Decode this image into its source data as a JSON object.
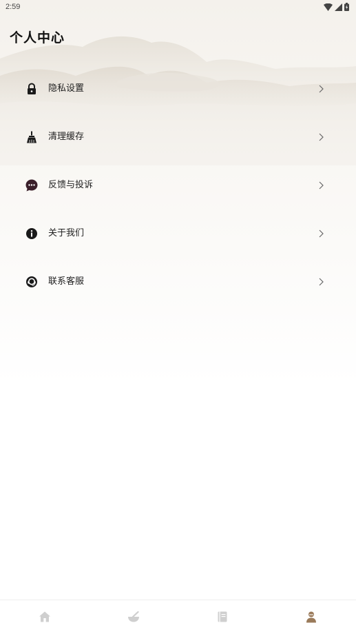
{
  "status_bar": {
    "time": "2:59"
  },
  "header": {
    "title": "个人中心"
  },
  "menu": {
    "items": [
      {
        "label": "隐私设置",
        "icon": "lock-icon"
      },
      {
        "label": "清理缓存",
        "icon": "broom-icon"
      },
      {
        "label": "反馈与投诉",
        "icon": "chat-bubble-icon"
      },
      {
        "label": "关于我们",
        "icon": "info-icon"
      },
      {
        "label": "联系客服",
        "icon": "support-icon"
      }
    ]
  },
  "tabbar": {
    "tabs": [
      {
        "icon": "home-icon",
        "active": false
      },
      {
        "icon": "mortar-bowl-icon",
        "active": false
      },
      {
        "icon": "book-icon",
        "active": false
      },
      {
        "icon": "user-icon",
        "active": true
      }
    ],
    "active_color": "#9a7a5a",
    "inactive_color": "#cfcfcf"
  },
  "colors": {
    "icon": "#1a1a1a",
    "accent": "#3a1f2a"
  }
}
